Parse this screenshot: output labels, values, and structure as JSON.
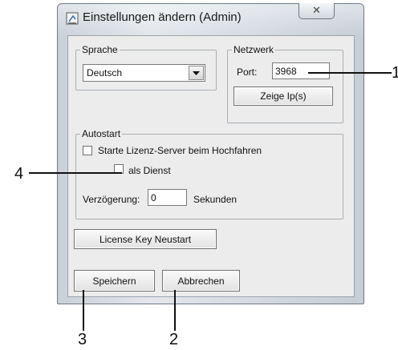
{
  "dialog": {
    "title": "Einstellungen ändern (Admin)",
    "close_glyph": "✕",
    "title_icon": "settings-app-icon"
  },
  "language_group": {
    "legend": "Sprache",
    "selected": "Deutsch"
  },
  "network_group": {
    "legend": "Netzwerk",
    "port_label": "Port:",
    "port_value": "3968",
    "show_ips_button": "Zeige Ip(s)"
  },
  "autostart_group": {
    "legend": "Autostart",
    "start_server_label": "Starte Lizenz-Server beim Hochfahren",
    "start_server_checked": false,
    "as_service_label": "als Dienst",
    "as_service_checked": false,
    "delay_label": "Verzögerung:",
    "delay_value": "0",
    "delay_unit": "Sekunden"
  },
  "buttons": {
    "license_key_restart": "License Key Neustart",
    "save": "Speichern",
    "cancel": "Abbrechen"
  },
  "callouts": {
    "one": "1",
    "two": "2",
    "three": "3",
    "four": "4"
  }
}
